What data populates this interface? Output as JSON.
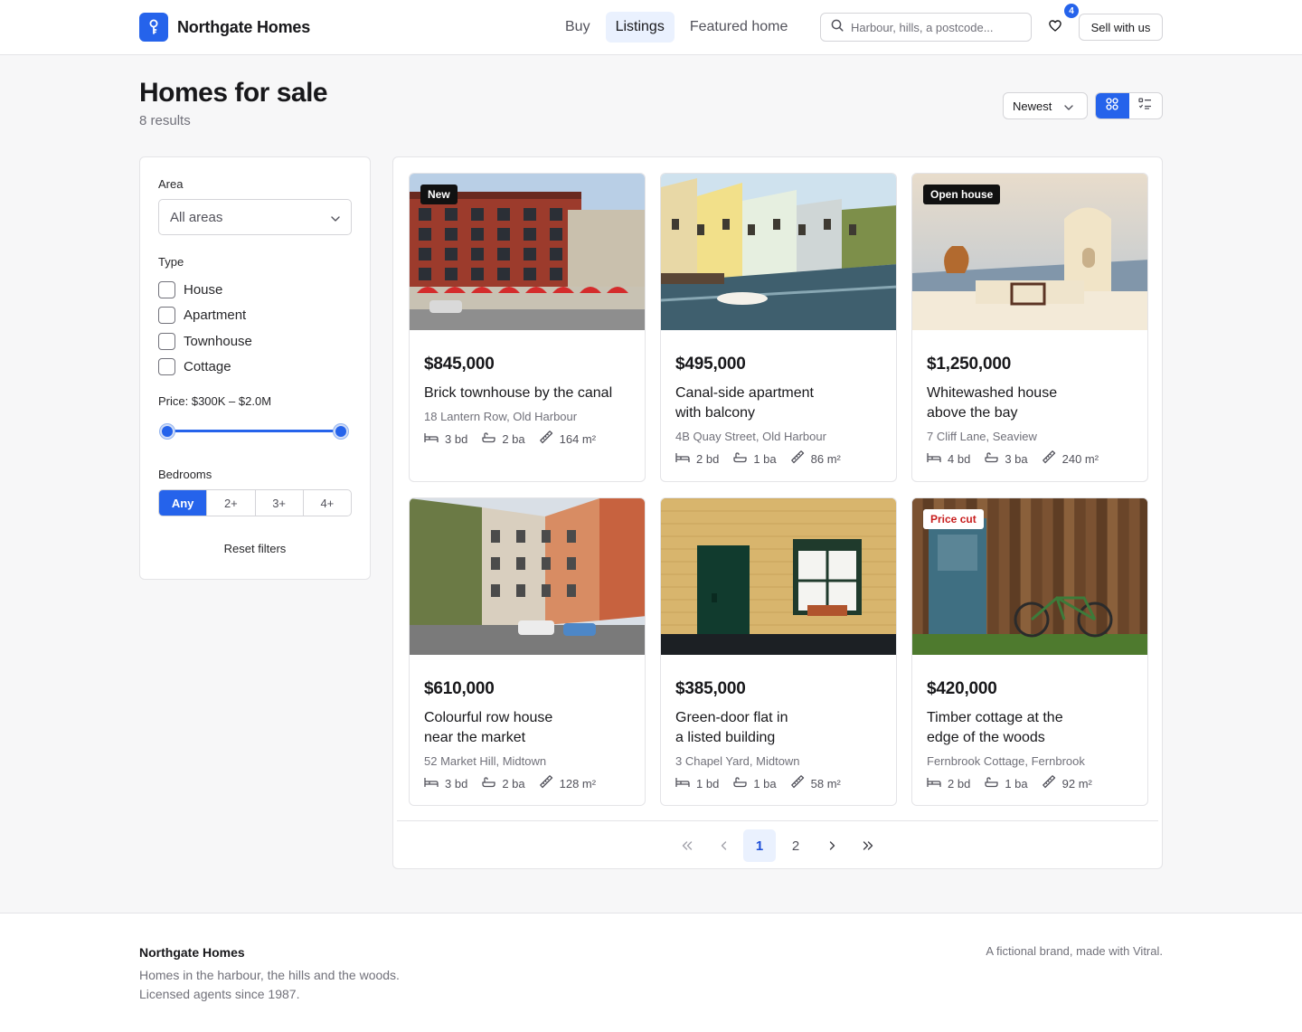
{
  "header": {
    "brand": "Northgate Homes",
    "nav": [
      "Buy",
      "Listings",
      "Featured home"
    ],
    "nav_active": "Listings",
    "search_placeholder": "Harbour, hills, a postcode...",
    "favorites_count": "4",
    "sell_label": "Sell with us",
    "accent_color": "#2563eb"
  },
  "page": {
    "title": "Homes for sale",
    "result_count": "8 results",
    "sort_value": "Newest",
    "view_mode": "grid"
  },
  "filters": {
    "area_label": "Area",
    "area_value": "All areas",
    "type_label": "Type",
    "types": [
      "House",
      "Apartment",
      "Townhouse",
      "Cottage"
    ],
    "price_label": "Price: $300K – $2.0M",
    "price_range_fraction": [
      0,
      1
    ],
    "bedrooms_label": "Bedrooms",
    "bedroom_options": [
      "Any",
      "2+",
      "3+",
      "4+"
    ],
    "bedroom_selected": "Any",
    "reset_label": "Reset filters"
  },
  "listings": [
    {
      "price": "$845,000",
      "title": "Brick townhouse by the canal",
      "address": "18 Lantern Row, Old Harbour",
      "beds": "3 bd",
      "baths": "2 ba",
      "area": "164 m²",
      "badge": "New",
      "badge_style": "dark",
      "photo": "brick-corner-building"
    },
    {
      "price": "$495,000",
      "title": "Canal-side apartment\nwith balcony",
      "address": "4B Quay Street, Old Harbour",
      "beds": "2 bd",
      "baths": "1 ba",
      "area": "86 m²",
      "badge": "",
      "badge_style": "",
      "photo": "canal-houses"
    },
    {
      "price": "$1,250,000",
      "title": "Whitewashed house\nabove the bay",
      "address": "7 Cliff Lane, Seaview",
      "beds": "4 bd",
      "baths": "3 ba",
      "area": "240 m²",
      "badge": "Open house",
      "badge_style": "dark",
      "photo": "whitewashed-terrace"
    },
    {
      "price": "$610,000",
      "title": "Colourful row house\nnear the market",
      "address": "52 Market Hill, Midtown",
      "beds": "3 bd",
      "baths": "2 ba",
      "area": "128 m²",
      "badge": "",
      "badge_style": "",
      "photo": "colourful-street"
    },
    {
      "price": "$385,000",
      "title": "Green-door flat in\na listed building",
      "address": "3 Chapel Yard, Midtown",
      "beds": "1 bd",
      "baths": "1 ba",
      "area": "58 m²",
      "badge": "",
      "badge_style": "",
      "photo": "green-door-facade"
    },
    {
      "price": "$420,000",
      "title": "Timber cottage at the\nedge of the woods",
      "address": "Fernbrook Cottage, Fernbrook",
      "beds": "2 bd",
      "baths": "1 ba",
      "area": "92 m²",
      "badge": "Price cut",
      "badge_style": "light",
      "photo": "timber-shed-bicycle"
    }
  ],
  "pagination": {
    "pages": [
      "1",
      "2"
    ],
    "current": "1"
  },
  "footer": {
    "brand": "Northgate Homes",
    "tagline_1": "Homes in the harbour, the hills and the woods.",
    "tagline_2": "Licensed agents since 1987.",
    "note": "A fictional brand, made with Vitral."
  }
}
